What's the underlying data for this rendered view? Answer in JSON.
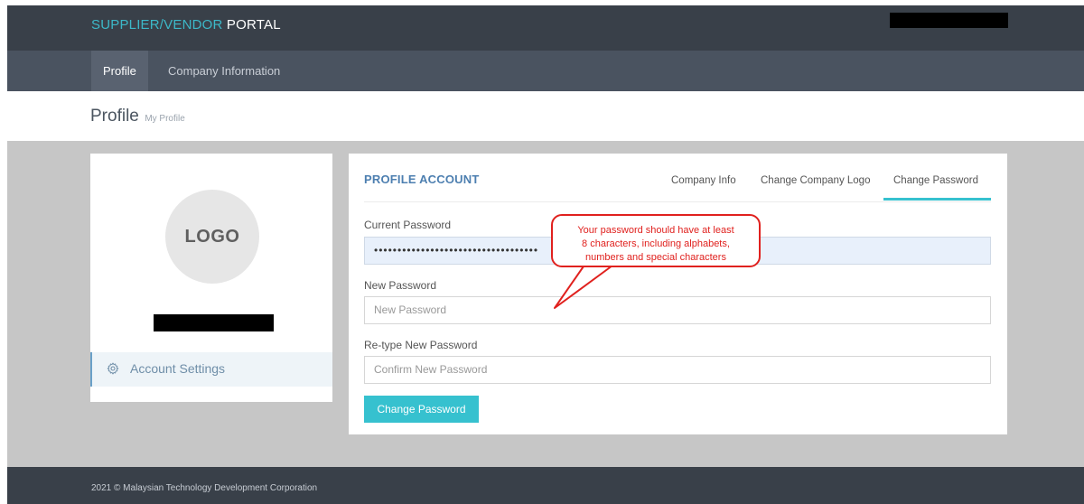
{
  "header": {
    "brand_part1": "SUPPLIER/VENDOR",
    "brand_part2": "PORTAL",
    "brand_color": "#3cb8c8"
  },
  "nav": {
    "tabs": [
      {
        "label": "Profile",
        "active": true
      },
      {
        "label": "Company Information",
        "active": false
      }
    ]
  },
  "page": {
    "title": "Profile",
    "subtitle": "My Profile"
  },
  "sidebar": {
    "logo_text": "LOGO",
    "account_settings_label": "Account Settings",
    "account_settings_icon": "gear-icon"
  },
  "profile_account": {
    "title": "PROFILE ACCOUNT",
    "tabs": [
      {
        "label": "Company Info",
        "active": false
      },
      {
        "label": "Change Company Logo",
        "active": false
      },
      {
        "label": "Change Password",
        "active": true
      }
    ],
    "fields": {
      "current_password": {
        "label": "Current Password",
        "value": "•••••••••••••••••••••••••••••••••••"
      },
      "new_password": {
        "label": "New Password",
        "placeholder": "New Password"
      },
      "retype_password": {
        "label": "Re-type New Password",
        "placeholder": "Confirm New Password"
      }
    },
    "submit_label": "Change Password",
    "accent_color": "#36c1cf"
  },
  "callout": {
    "line1": "Your password should have at least",
    "line2": "8 characters, including alphabets,",
    "line3": "numbers and special characters",
    "color": "#e0211e"
  },
  "footer": {
    "text": "2021 © Malaysian Technology Development Corporation"
  }
}
